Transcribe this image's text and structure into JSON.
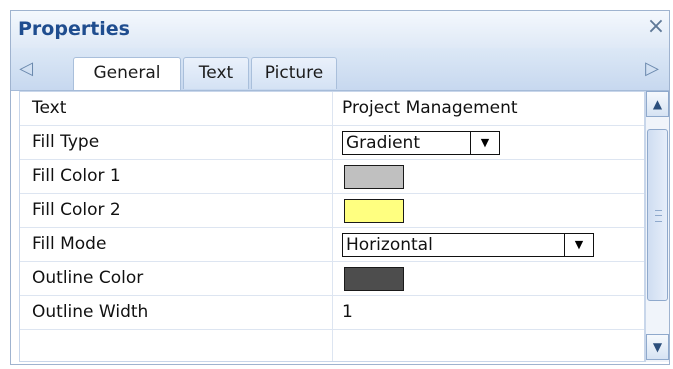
{
  "panel": {
    "title": "Properties",
    "close_icon": "×"
  },
  "tabs": {
    "scroll_left_icon": "◁",
    "scroll_right_icon": "▷",
    "items": [
      {
        "label": "General",
        "active": true
      },
      {
        "label": "Text",
        "active": false
      },
      {
        "label": "Picture",
        "active": false
      }
    ]
  },
  "properties": [
    {
      "name": "Text",
      "value": "Project Management",
      "kind": "text"
    },
    {
      "name": "Fill Type",
      "value": "Gradient",
      "kind": "dropdown"
    },
    {
      "name": "Fill Color 1",
      "value": "#c0c0c0",
      "kind": "color"
    },
    {
      "name": "Fill Color 2",
      "value": "#ffff80",
      "kind": "color"
    },
    {
      "name": "Fill Mode",
      "value": "Horizontal",
      "kind": "dropdown"
    },
    {
      "name": "Outline Color",
      "value": "#4d4d4d",
      "kind": "color"
    },
    {
      "name": "Outline Width",
      "value": "1",
      "kind": "text"
    }
  ],
  "dropdown_arrow": "▼",
  "scrollbar": {
    "up_icon": "▲",
    "down_icon": "▼"
  }
}
